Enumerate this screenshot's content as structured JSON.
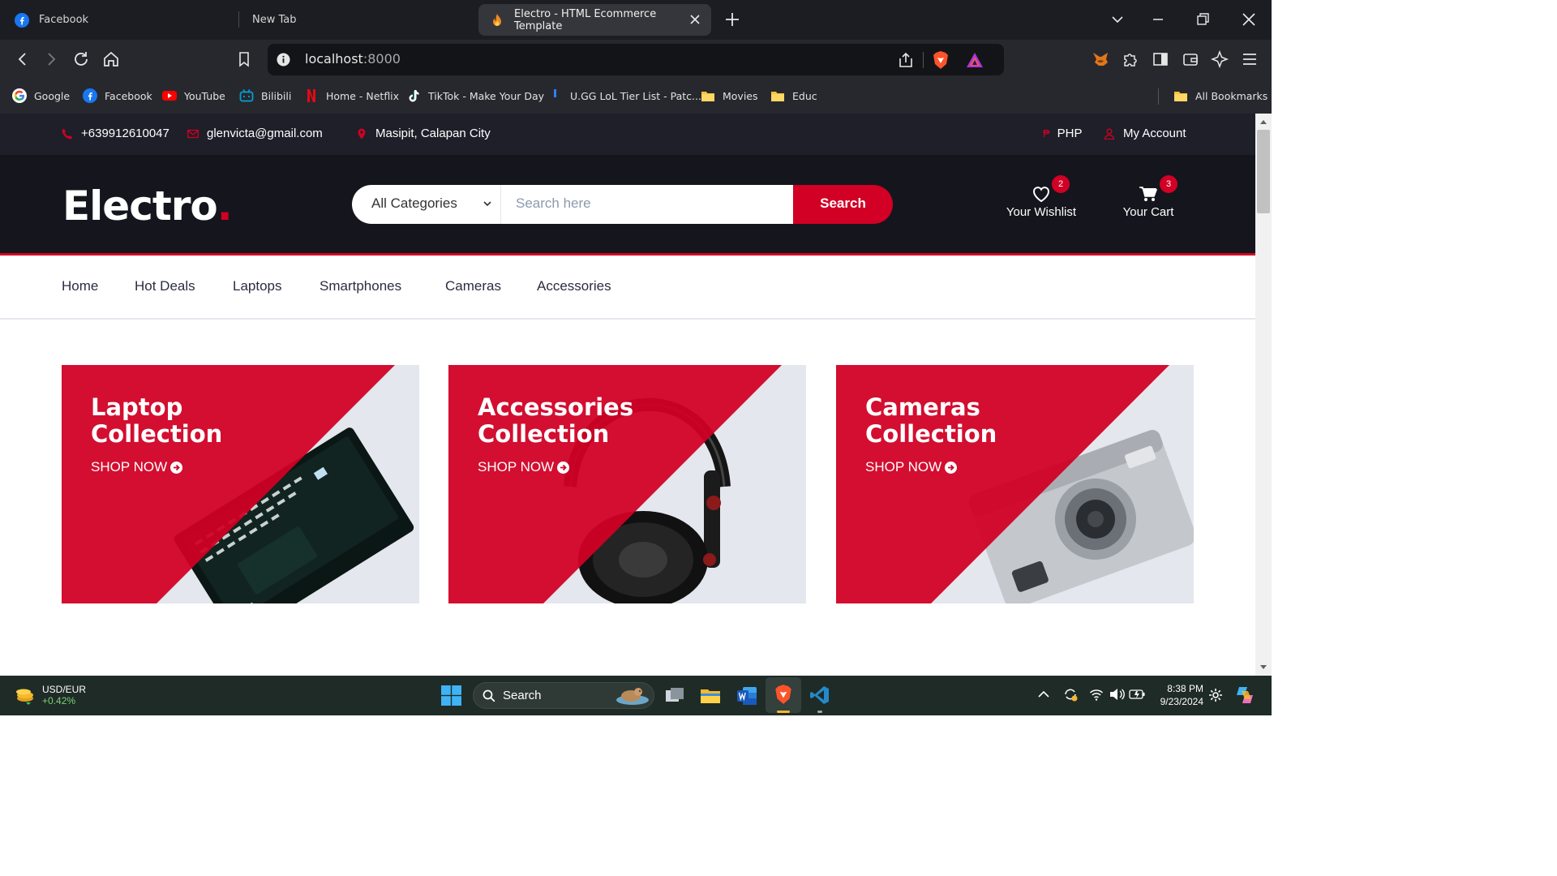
{
  "browser": {
    "tabs": [
      {
        "title": "Facebook",
        "icon": "facebook-icon",
        "active": false
      },
      {
        "title": "New Tab",
        "icon": "",
        "active": false
      },
      {
        "title": "Electro - HTML Ecommerce Template",
        "icon": "fire-icon",
        "active": true
      }
    ],
    "url_host": "localhost",
    "url_port": ":8000",
    "bookmarks": [
      {
        "label": "Google",
        "icon": "google-icon"
      },
      {
        "label": "Facebook",
        "icon": "facebook-icon"
      },
      {
        "label": "YouTube",
        "icon": "youtube-icon"
      },
      {
        "label": "Bilibili",
        "icon": "bilibili-icon"
      },
      {
        "label": "Home - Netflix",
        "icon": "netflix-icon"
      },
      {
        "label": "TikTok - Make Your Day",
        "icon": "tiktok-icon"
      },
      {
        "label": "U.GG LoL Tier List - Patc...",
        "icon": "ugg-icon"
      },
      {
        "label": "Movies",
        "icon": "folder-icon"
      },
      {
        "label": "Educ",
        "icon": "folder-icon"
      }
    ],
    "all_bookmarks": "All Bookmarks"
  },
  "topbar": {
    "phone": "+639912610047",
    "email": "glenvicta@gmail.com",
    "location": "Masipit, Calapan City",
    "currency": "PHP",
    "currency_symbol": "₱",
    "account": "My Account"
  },
  "header": {
    "logo_text": "Electro",
    "logo_dot": ".",
    "category_selected": "All Categories",
    "search_placeholder": "Search here",
    "search_button": "Search",
    "wishlist_label": "Your Wishlist",
    "wishlist_count": "2",
    "cart_label": "Your Cart",
    "cart_count": "3"
  },
  "nav": [
    "Home",
    "Hot Deals",
    "Laptops",
    "Smartphones",
    "Cameras",
    "Accessories"
  ],
  "collections": [
    {
      "line1": "Laptop",
      "line2": "Collection",
      "cta": "SHOP NOW"
    },
    {
      "line1": "Accessories",
      "line2": "Collection",
      "cta": "SHOP NOW"
    },
    {
      "line1": "Cameras",
      "line2": "Collection",
      "cta": "SHOP NOW"
    }
  ],
  "taskbar": {
    "ticker_name": "USD/EUR",
    "ticker_change": "+0.42%",
    "search": "Search",
    "time": "8:38 PM",
    "date": "9/23/2024"
  },
  "colors": {
    "brand_red": "#D10024",
    "header_dark": "#15161D",
    "topbar_dark": "#1E1F29"
  }
}
